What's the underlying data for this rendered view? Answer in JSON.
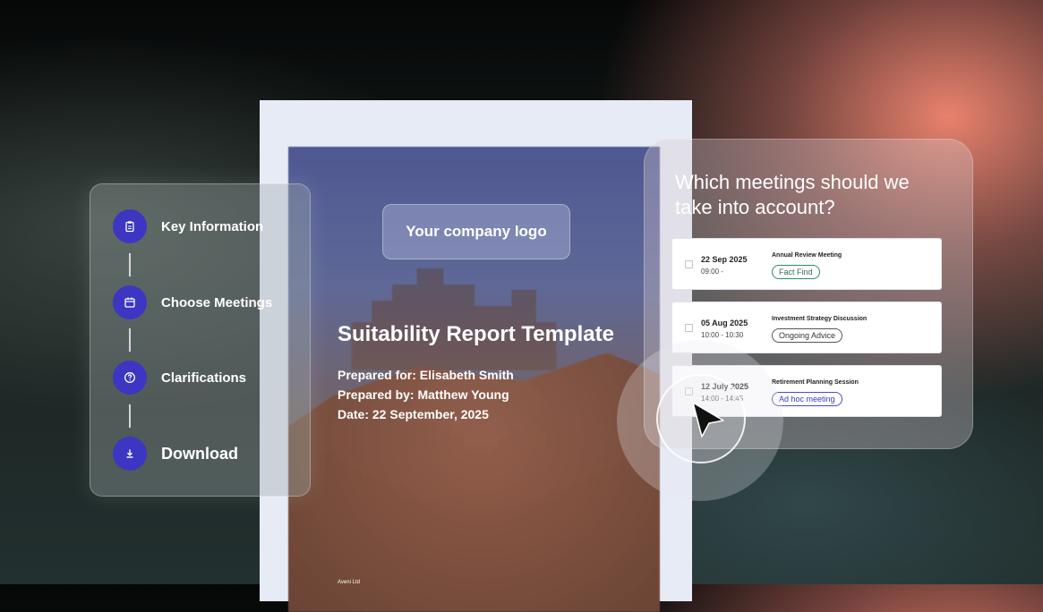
{
  "steps": [
    {
      "label": "Key Information",
      "icon": "clipboard-icon"
    },
    {
      "label": "Choose Meetings",
      "icon": "calendar-icon"
    },
    {
      "label": "Clarifications",
      "icon": "question-icon"
    },
    {
      "label": "Download",
      "icon": "download-icon"
    }
  ],
  "document": {
    "logo_placeholder": "Your company logo",
    "title": "Suitability Report Template",
    "prepared_for": "Prepared for: Elisabeth Smith",
    "prepared_by": "Prepared by: Matthew Young",
    "date": "Date: 22 September, 2025",
    "footer": "Aveni Ltd"
  },
  "meetings": {
    "question": "Which meetings should we take into account?",
    "items": [
      {
        "date": "22 Sep 2025",
        "time": "09:00 -",
        "name": "Annual Review Meeting",
        "tag": "Fact Find",
        "tag_color": "#2f8a63"
      },
      {
        "date": "05 Aug 2025",
        "time": "10:00 - 10:30",
        "name": "Investment Strategy Discussion",
        "tag": "Ongoing Advice",
        "tag_color": "#555555"
      },
      {
        "date": "12 July 2025",
        "time": "14:00 - 14:45",
        "name": "Retirement Planning Session",
        "tag": "Ad hoc meeting",
        "tag_color": "#4b48c9"
      }
    ]
  },
  "colors": {
    "accent": "#3c36c2"
  }
}
